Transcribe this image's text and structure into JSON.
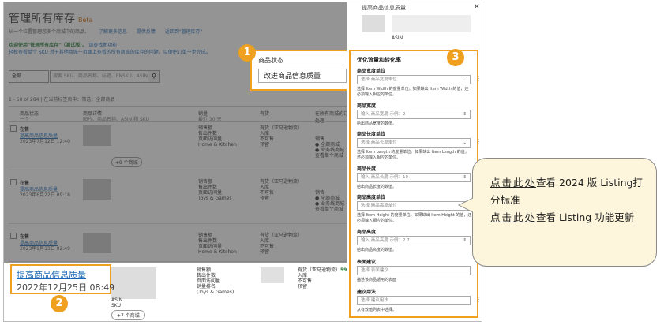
{
  "background": {
    "title": "管理所有库存",
    "title_tag": "Beta",
    "subtitle": "从一个位置管理您多个商城中的商品。",
    "subtitle_links": [
      "了解更多信息",
      "提供反馈",
      "返回到\"管理库存\""
    ],
    "notice_title": "欢迎使用\"管理所有库存\"（测试版）。",
    "notice_link": "请查找新功能",
    "notice_text": "轻松查看单个 SKU 对于其他商城一页面上查看的所有商城的库存的问题，以便把订单一步完成。",
    "search_select": "全部",
    "search_placeholder": "搜索 SKU、商品名称、标题、FNSKU、ASIN、以及 A",
    "search_icon": "search-icon",
    "count_text": "1 - 50 of 284 | 在当前标签页中：筛选：全部商品",
    "columns": [
      "商品状态",
      "商品详情",
      "销量",
      "有货",
      "在所有商城的订单处理"
    ],
    "column_subs": [
      "一个",
      "图片、商品名称、ASIN 和 SKU",
      "最近 30 天",
      "",
      ""
    ],
    "rows": [
      {
        "status": "在售",
        "link": "提高商品信息质量",
        "date": "2023年7月12日 12:40",
        "sales": [
          "销售额",
          "售出件数",
          "页面访问量",
          "Home & Kitchen"
        ],
        "stock": [
          "有货（亚马逊物流）",
          "入库",
          "不可售",
          "预留"
        ],
        "market": "+9 个商城"
      },
      {
        "status": "在售",
        "link": "提高商品信息质量",
        "date": "2023年6月22日 09:18",
        "sales": [
          "销售额",
          "售出件数",
          "页面访问量",
          "Toys & Games"
        ],
        "stock": [
          "有货（亚马逊物流）",
          "入库",
          "不可售",
          "预留"
        ],
        "market": ""
      },
      {
        "status": "在售",
        "link": "提高商品信息质量",
        "date": "2023年9月13日 02:49",
        "sales": [
          "销售额",
          "售出件数",
          "页面访问量",
          "Home & Kitchen"
        ],
        "stock": [
          "有货（亚马逊物流）",
          "入库",
          "不可售",
          "预留"
        ],
        "market": ""
      }
    ],
    "row_dot_labels": [
      "销售",
      "● 全部商城",
      "● 业务线商城",
      "查看单个商城"
    ]
  },
  "status_callout": {
    "label": "商品状态",
    "value": "改进商品信息质量"
  },
  "bottom_row": {
    "quality_title": "提高商品信息质量",
    "quality_date": "2022年12月25日 08:49",
    "asin_label": "ASIN",
    "sku_label": "SKU",
    "market": "+7 个商城",
    "sales": [
      "销售额",
      "售出件数",
      "页面访问量",
      "销量排名",
      "(Toys & Games)"
    ],
    "stock": [
      "有货（亚马逊物流）",
      "入库",
      "不可售",
      "预留"
    ],
    "num": "59"
  },
  "panel": {
    "top_title": "提高商品信息质量",
    "asin_label": "ASIN",
    "section_title": "优化流量和转化率",
    "fields": [
      {
        "label": "商品宽度单位",
        "placeholder": "选择 商品宽度单位",
        "type": "select",
        "help": "选择 Item Width 的度量单位。如果缺出 Item Width 的值，还必须输入相应的单位。"
      },
      {
        "label": "商品宽度",
        "placeholder": "输入 商品宽度 示例：2",
        "type": "number",
        "help": "给出商品宽度的数值。"
      },
      {
        "label": "商品长度单位",
        "placeholder": "选择 商品长度单位",
        "type": "select",
        "help": "选择 Item Length 的度量单位。如果缺出 Item Length 的值，还必须输入相应的单位。"
      },
      {
        "label": "商品长度",
        "placeholder": "输入 商品长度 示例：10",
        "type": "number",
        "help": "给出商品长度的数值。"
      },
      {
        "label": "商品高度单位",
        "placeholder": "选择 商品高度单位",
        "type": "select",
        "help": "选择 Item Height 的度量单位。如果缺出 Item Height 的值，还必须输入相应的单位。"
      },
      {
        "label": "商品高度",
        "placeholder": "输入 商品高度 示例：2.7",
        "type": "number",
        "help": "给出商品高度的数值。"
      },
      {
        "label": "表面建议",
        "placeholder": "选择 表面建议",
        "type": "text",
        "help": "描述该商品适用的表面"
      },
      {
        "label": "建议用法",
        "placeholder": "选择 建议用法",
        "type": "text",
        "help": "从有效值列表中选择。"
      }
    ]
  },
  "badges": [
    "1",
    "2",
    "3"
  ],
  "bubble": {
    "link1": "点击此处",
    "text1": "查看 2024 版 Listing打分标准",
    "link2": "点击此处",
    "text2": "查看 Listing 功能更新"
  },
  "colors": {
    "accent": "#f0a020",
    "link": "#1a66b4",
    "bubble_bg": "#fdf6dc"
  }
}
